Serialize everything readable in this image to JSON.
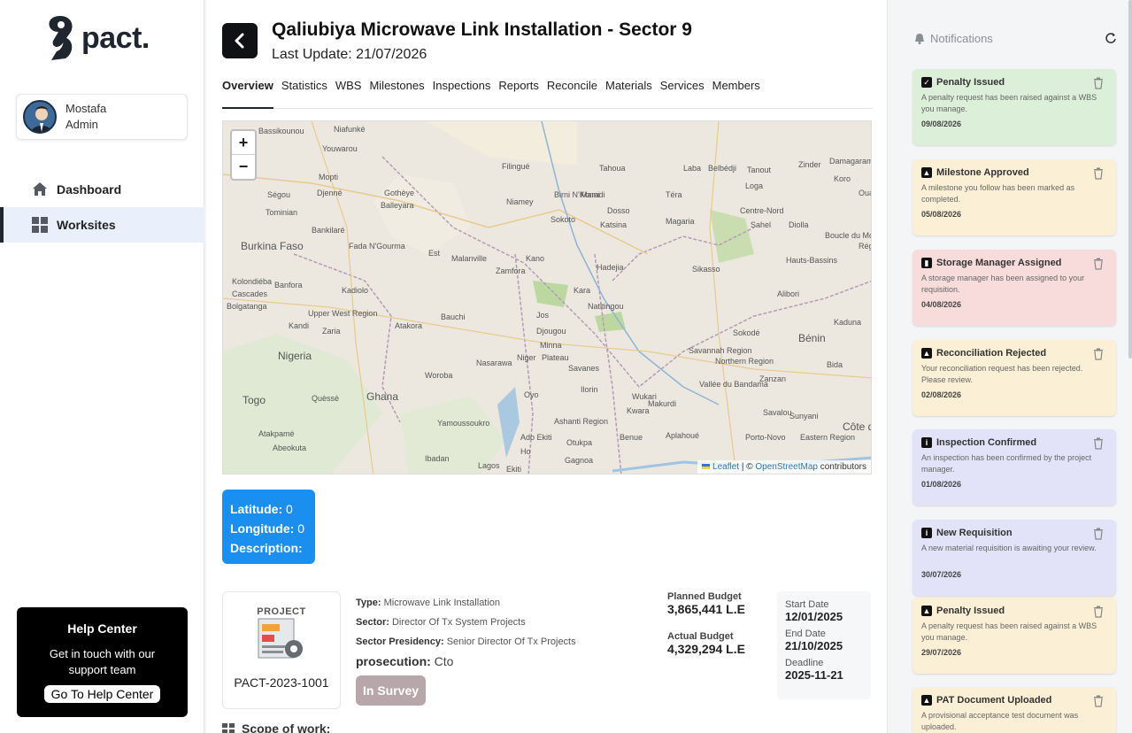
{
  "brand": {
    "name": "pact."
  },
  "user": {
    "name": "Mostafa",
    "role": "Admin"
  },
  "nav": [
    {
      "label": "Dashboard",
      "icon": "home-icon"
    },
    {
      "label": "Worksites",
      "icon": "grid-icon"
    }
  ],
  "help": {
    "title": "Help Center",
    "desc": "Get in touch with our support team",
    "button": "Go To Help Center"
  },
  "page": {
    "title": "Qaliubiya Microwave Link Installation - Sector 9",
    "subtitle": "Last Update: 21/07/2026"
  },
  "tabs": [
    "Overview",
    "Statistics",
    "WBS",
    "Milestones",
    "Inspections",
    "Reports",
    "Reconcile",
    "Materials",
    "Services",
    "Members"
  ],
  "map": {
    "zoom_in": "+",
    "zoom_out": "−",
    "attribution_link1": "Leaflet",
    "attribution_sep": " | © ",
    "attribution_link2": "OpenStreetMap",
    "attribution_suffix": " contributors",
    "labels": [
      "Bassikounou",
      "Niafunké",
      "Youwarou",
      "Mopti",
      "Djenné",
      "Ségou",
      "Tominian",
      "Bankilaré",
      "Filingué",
      "Tahoua",
      "Laba",
      "Belbédji",
      "Tanout",
      "Zinder",
      "Damagaram Takaya",
      "Koro",
      "Ouahigouya",
      "Gothèye",
      "Balleyara",
      "Birni N'Konni",
      "Maradi",
      "Téra",
      "Loga",
      "Niamey",
      "Dosso",
      "Sokoto",
      "Katsina",
      "Magaria",
      "Centre-Nord",
      "Sahel",
      "Diolla",
      "Boucle du Mouhoun",
      "Burkina Faso",
      "Fada N'Gourma",
      "Est",
      "Malanville",
      "Zamfora",
      "Kano",
      "Hadejia",
      "Sikasso",
      "Hauts-Bassins",
      "Région de Sikasso",
      "Kolondiéba",
      "Banfora",
      "Kadiolo",
      "Cascades",
      "Bolgatanga",
      "Upper West Region",
      "Kandi",
      "Zaria",
      "Bauchi",
      "Atakora",
      "Natitingou",
      "Alibori",
      "Kaduna",
      "Jos",
      "Djougou",
      "Kara",
      "Sokodé",
      "Bénin",
      "Minna",
      "Niger",
      "Plateau",
      "Savanes",
      "Northern Region",
      "Savannah Region",
      "Bida",
      "Nigeria",
      "Nasarawa",
      "Woroba",
      "Vallée du Bandama",
      "Zanzan",
      "Togo",
      "Quèssè",
      "Ghana",
      "Oyo",
      "Ilorin",
      "Kwara",
      "Makurdi",
      "Wukari",
      "Sunyani",
      "Savalou",
      "Côte d'Ivoire",
      "Yamoussoukro",
      "Ashanti Region",
      "Atakpamé",
      "Abeokuta",
      "Ibadan",
      "Ado Ekiti",
      "Otukpa",
      "Benue",
      "Aplahoué",
      "Porto-Novo",
      "Eastern Region",
      "Ho",
      "Gagnoa",
      "Lagos",
      "Ekiti"
    ]
  },
  "coords": {
    "lat_label": "Latitude:",
    "lat": "0",
    "lng_label": "Longitude:",
    "lng": "0",
    "desc_label": "Description:",
    "desc": ""
  },
  "project": {
    "icon_label": "PROJECT",
    "code": "PACT-2023-1001",
    "type_label": "Type:",
    "type": "Microwave Link Installation",
    "sector_label": "Sector:",
    "sector": "Director Of Tx System Projects",
    "presidency_label": "Sector Presidency:",
    "presidency": "Senior Director Of Tx Projects",
    "prosecution_label": "prosecution:",
    "prosecution": "Cto",
    "status": "In Survey"
  },
  "budget": {
    "planned_label": "Planned Budget",
    "planned": "3,865,441 L.E",
    "actual_label": "Actual Budget",
    "actual": "4,329,294 L.E"
  },
  "dates": {
    "start_label": "Start Date",
    "start": "12/01/2025",
    "end_label": "End Date",
    "end": "21/10/2025",
    "deadline_label": "Deadline",
    "deadline": "2025-11-21"
  },
  "scope_label": "Scope of work:",
  "notifications_title": "Notifications",
  "notifications": [
    {
      "title": "Penalty Issued",
      "desc": "A penalty request has been raised against a WBS you manage.",
      "date": "09/08/2026",
      "icon": "check-icon",
      "glyph": "✓",
      "bg": "#dcefd9"
    },
    {
      "title": "Milestone Approved",
      "desc": "A milestone you follow has been marked as completed.",
      "date": "05/08/2026",
      "icon": "warning-icon",
      "glyph": "▲",
      "bg": "#fbefd6"
    },
    {
      "title": "Storage Manager Assigned",
      "desc": "A storage manager has been assigned to your requisition.",
      "date": "04/08/2026",
      "icon": "chart-icon",
      "glyph": "▮",
      "bg": "#f8dcdc"
    },
    {
      "title": "Reconciliation Rejected",
      "desc": "Your reconciliation request has been rejected. Please review.",
      "date": "02/08/2026",
      "icon": "warning-icon",
      "glyph": "▲",
      "bg": "#fbefd6"
    },
    {
      "title": "Inspection Confirmed",
      "desc": "An inspection has been confirmed by the project manager.",
      "date": "01/08/2026",
      "icon": "info-icon",
      "glyph": "i",
      "bg": "#e2e2f8"
    },
    {
      "title": "New Requisition",
      "desc": "A new material requisition is awaiting your review.",
      "date": "30/07/2026",
      "icon": "info-icon",
      "glyph": "i",
      "bg": "#e2e2f8"
    },
    {
      "title": "Penalty Issued",
      "desc": "A penalty request has been raised against a WBS you manage.",
      "date": "29/07/2026",
      "icon": "warning-icon",
      "glyph": "▲",
      "bg": "#fbefd6"
    },
    {
      "title": "PAT Document Uploaded",
      "desc": "A provisional acceptance test document was uploaded.",
      "date": "",
      "icon": "warning-icon",
      "glyph": "▲",
      "bg": "#fbefd6"
    }
  ]
}
